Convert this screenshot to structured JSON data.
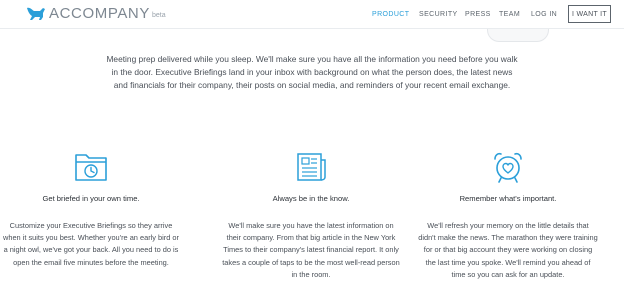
{
  "brand": {
    "name": "ACCOMPANY",
    "tag": "beta",
    "color": "#2b9fd9"
  },
  "nav": {
    "links": [
      {
        "label": "PRODUCT",
        "active": true
      },
      {
        "label": "SECURITY",
        "active": false
      },
      {
        "label": "PRESS",
        "active": false
      },
      {
        "label": "TEAM",
        "active": false
      },
      {
        "label": "LOG IN",
        "active": false
      }
    ],
    "cta_label": "I WANT IT"
  },
  "intro": "Meeting prep delivered while you sleep. We'll make sure you have all the information you need before you walk in the door. Executive Briefings land in your inbox with background on what the person does, the latest news and financials for their company, their posts on social media, and reminders of your recent email exchange.",
  "features": [
    {
      "icon": "folder-clock-icon",
      "title": "Get briefed in your own time.",
      "body": "Customize your Executive Briefings so they arrive when it suits you best. Whether you're an early bird or a night owl, we've got your back. All you need to do is open the email five minutes before the meeting."
    },
    {
      "icon": "newspaper-icon",
      "title": "Always be in the know.",
      "body": "We'll make sure you have the latest information on their company. From that big article in the New York Times to their company's latest financial report. It only takes a couple of taps to be the most well-read person in the room."
    },
    {
      "icon": "alarm-clock-heart-icon",
      "title": "Remember what's important.",
      "body": "We'll refresh your memory on the little details that didn't make the news. The marathon they were training for or that big account they were working on closing the last time you spoke. We'll remind you ahead of time so you can ask for an update."
    }
  ]
}
